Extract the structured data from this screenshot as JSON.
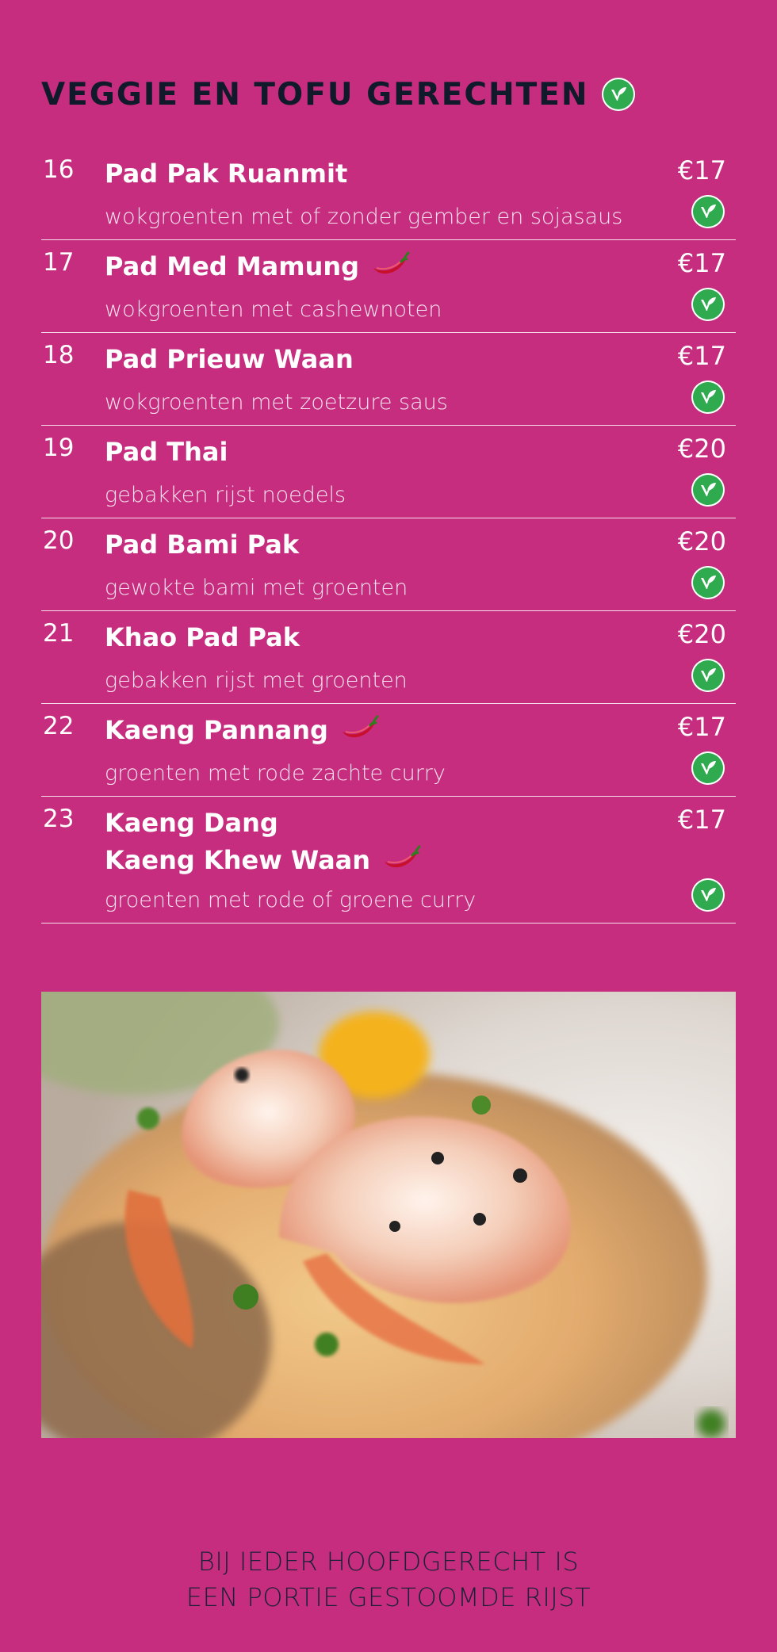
{
  "section": {
    "title": "VEGGIE EN TOFU GERECHTEN",
    "title_icon": "vegan-leaf-icon"
  },
  "menu": {
    "items": [
      {
        "number": "16",
        "names": [
          "Pad Pak Ruanmit"
        ],
        "spicy": false,
        "description": "wokgroenten met of zonder gember en sojasaus",
        "price": "€17",
        "vegan": true
      },
      {
        "number": "17",
        "names": [
          "Pad Med Mamung"
        ],
        "spicy": true,
        "description": "wokgroenten met cashewnoten",
        "price": "€17",
        "vegan": true
      },
      {
        "number": "18",
        "names": [
          "Pad Prieuw Waan"
        ],
        "spicy": false,
        "description": "wokgroenten met zoetzure saus",
        "price": "€17",
        "vegan": true
      },
      {
        "number": "19",
        "names": [
          "Pad Thai"
        ],
        "spicy": false,
        "description": "gebakken rijst noedels",
        "price": "€20",
        "vegan": true
      },
      {
        "number": "20",
        "names": [
          "Pad Bami Pak"
        ],
        "spicy": false,
        "description": "gewokte bami met groenten",
        "price": "€20",
        "vegan": true
      },
      {
        "number": "21",
        "names": [
          "Khao Pad Pak"
        ],
        "spicy": false,
        "description": "gebakken rijst met groenten",
        "price": "€20",
        "vegan": true
      },
      {
        "number": "22",
        "names": [
          "Kaeng Pannang"
        ],
        "spicy": true,
        "description": "groenten met rode zachte curry",
        "price": "€17",
        "vegan": true
      },
      {
        "number": "23",
        "names": [
          "Kaeng Dang",
          "Kaeng Khew Waan"
        ],
        "spicy": true,
        "description": "groenten met rode of groene curry",
        "price": "€17",
        "vegan": true
      }
    ]
  },
  "photo": {
    "icon": "food-photo-shrimp-pad-thai"
  },
  "footer": {
    "line1": "BIJ IEDER HOOFDGERECHT IS",
    "line2": "EEN PORTIE GESTOOMDE RIJST"
  },
  "colors": {
    "background": "#C62D7E",
    "title": "#111a2a",
    "vegan_badge": "#2faa4e",
    "chili": "#c8102e"
  }
}
